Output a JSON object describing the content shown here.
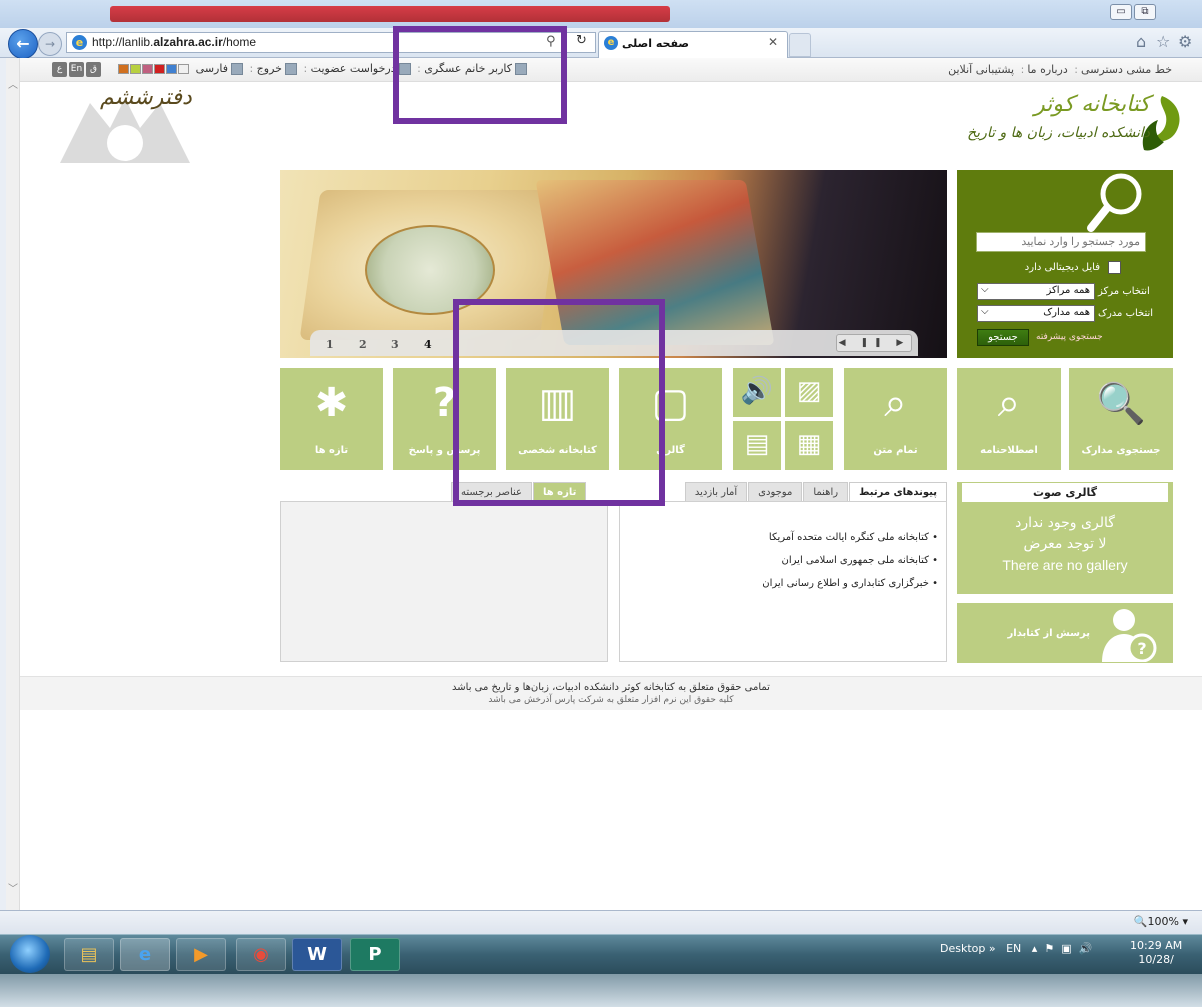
{
  "browser": {
    "url_prefix": "http://lanlib.",
    "url_domain": "alzahra.ac.ir",
    "url_suffix": "/home",
    "tab_title": "صفحه اصلی",
    "zoom": "100%"
  },
  "topbar": {
    "util_links": [
      "خط مشی دسترسی",
      "درباره ما",
      "پشتیبانی آنلاین"
    ],
    "user_items": [
      "کاربر خانم عسگری",
      "درخواست عضویت",
      "خروج",
      "فارسی"
    ],
    "lang_buttons": [
      "ق",
      "En",
      "ع"
    ],
    "swatch_colors": [
      "#d07020",
      "#b8d040",
      "#c06080",
      "#d02020",
      "#4080d0",
      "#f0f0f0"
    ]
  },
  "header": {
    "logo_title": "کتابخانه کوثر",
    "logo_subtitle": "دانشکده ادبیات، زبان ها و تاریخ"
  },
  "banner": {
    "text": "دفترششم",
    "slides": [
      "1",
      "2",
      "3",
      "4"
    ],
    "active_slide": "4",
    "control_glyphs": "◀ ❚❚ ▶"
  },
  "search": {
    "placeholder": "مورد جستجو را وارد نمایید",
    "digital_label": "فایل دیجیتالی دارد",
    "center_label": "انتخاب مرکز",
    "center_value": "همه مراکز",
    "doc_label": "انتخاب مدرک",
    "doc_value": "همه مدارک",
    "button": "جستجو",
    "advanced": "جستجوی پیشرفته"
  },
  "tiles": [
    {
      "label": "جستجوی مدارک",
      "icon": "document-search-icon",
      "glyph": "⌕"
    },
    {
      "label": "اصطلاحنامه",
      "icon": "network-search-icon",
      "glyph": "⌕"
    },
    {
      "label": "تمام متن",
      "icon": "fulltext-search-icon",
      "glyph": "⌕"
    },
    {
      "label": "گالری",
      "icon": "gallery-icon",
      "glyph": "▢"
    },
    {
      "label": "کتابخانه شخصی",
      "icon": "books-icon",
      "glyph": "▥"
    },
    {
      "label": "پرسش و پاسخ",
      "icon": "question-icon",
      "glyph": "?"
    },
    {
      "label": "تازه ها",
      "icon": "new-document-icon",
      "glyph": "✱"
    }
  ],
  "media_tiles": {
    "audio": "🔊",
    "image": "▨",
    "text": "▤",
    "video": "▦"
  },
  "right_tabs": [
    "پیوندهای مرتبط",
    "راهنما",
    "موجودی",
    "آمار بازدید"
  ],
  "links": [
    "• کتابخانه ملی کنگره ایالت متحده آمریکا",
    "• کتابخانه ملی جمهوری اسلامی ایران",
    "• خبرگزاری کتابداری و اطلاع رسانی ایران"
  ],
  "left_tabs": [
    "تازه ها",
    "عناصر برجسته"
  ],
  "gallery": {
    "title": "گالری صوت",
    "msg_fa": "گالری وجود ندارد",
    "msg_ar": "لا توجد معرض",
    "msg_en": "There are no gallery"
  },
  "ask": {
    "label": "پرسش از کتابدار"
  },
  "footer": {
    "line1": "تمامی حقوق متعلق به کتابخانه کوثر دانشکده ادبیات، زبان‌ها و تاریخ می باشد",
    "line2": "کلیه حقوق این نرم افزار متعلق به شرکت پارس آذرخش می باشد"
  },
  "taskbar": {
    "apps": [
      "explorer-icon",
      "ie-icon",
      "media-player-icon",
      "chrome-icon",
      "word-icon",
      "publisher-icon"
    ],
    "desktop": "Desktop",
    "lang": "EN",
    "time": "10:29 AM",
    "date": "10/28/"
  }
}
